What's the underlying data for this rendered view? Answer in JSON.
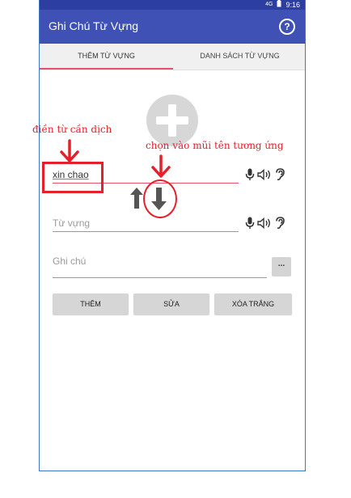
{
  "status_bar": {
    "signal": "4G",
    "time": "9:16"
  },
  "app": {
    "title": "Ghi Chú Từ Vựng",
    "help_icon": "help-circle-icon"
  },
  "tabs": [
    {
      "label": "THÊM TỪ VỰNG",
      "selected": true
    },
    {
      "label": "DANH SÁCH TỪ VỰNG",
      "selected": false
    }
  ],
  "form": {
    "source": {
      "value": "xin chao"
    },
    "vocab": {
      "placeholder": "Từ vựng"
    },
    "note": {
      "placeholder": "Ghi chú",
      "more_label": "..."
    }
  },
  "buttons": {
    "add": "THÊM",
    "edit": "SỬA",
    "clear": "XÓA TRẮNG"
  },
  "annotations": {
    "fill_word": "điền từ cần dịch",
    "choose_arrow": "chọn vào mũi tên tương ứng"
  },
  "colors": {
    "app_bar": "#3f51b5",
    "status_bar": "#2c3fa0",
    "accent": "#e8506d",
    "annotation": "#e4202a"
  }
}
